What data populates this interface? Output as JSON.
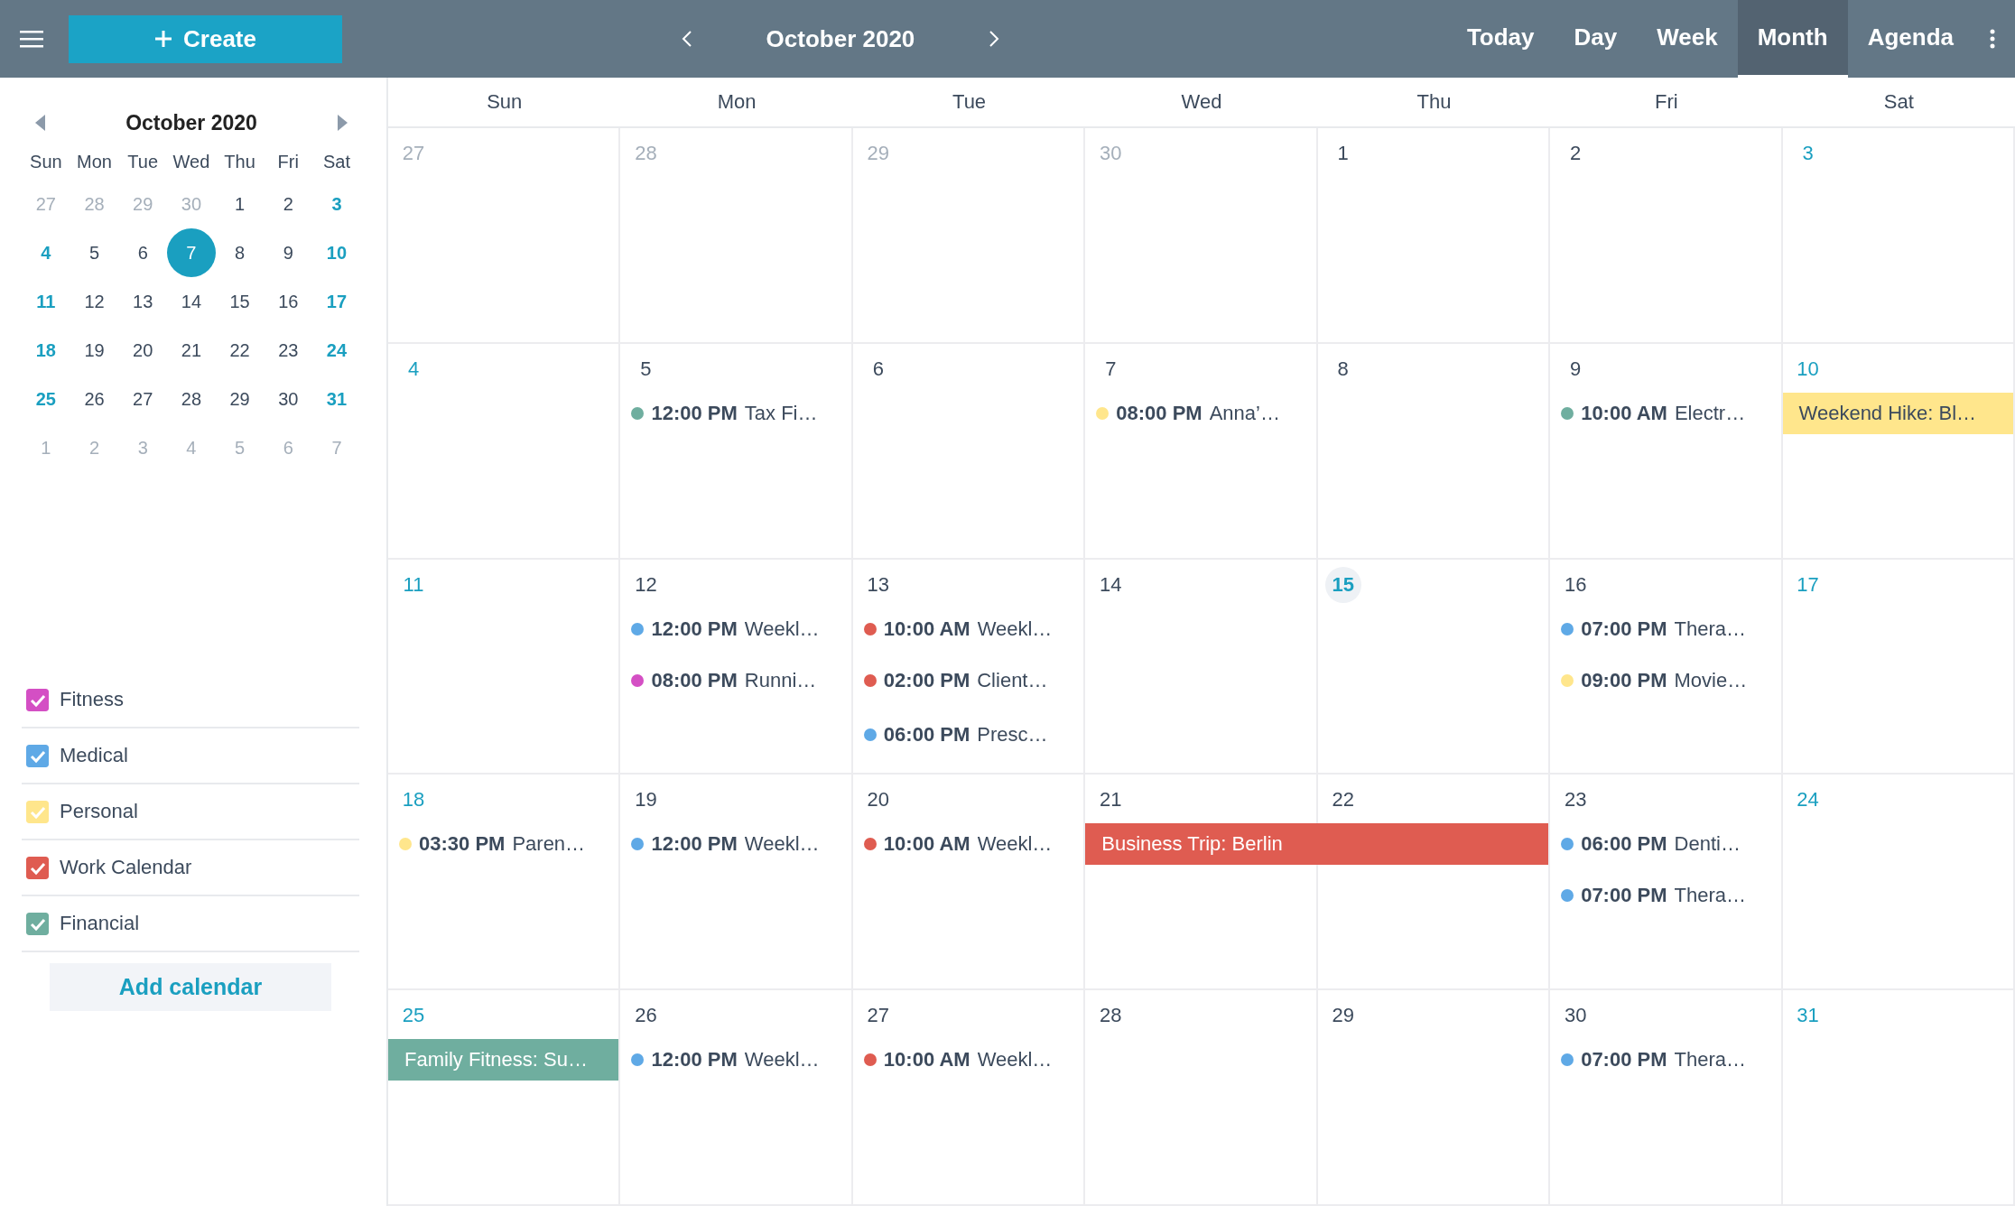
{
  "topbar": {
    "create_label": "Create",
    "title": "October 2020",
    "views": [
      {
        "label": "Today",
        "selected": false
      },
      {
        "label": "Day",
        "selected": false
      },
      {
        "label": "Week",
        "selected": false
      },
      {
        "label": "Month",
        "selected": true
      },
      {
        "label": "Agenda",
        "selected": false
      }
    ]
  },
  "sidebar": {
    "mini_calendar": {
      "title": "October 2020",
      "weekdays": [
        "Sun",
        "Mon",
        "Tue",
        "Wed",
        "Thu",
        "Fri",
        "Sat"
      ],
      "weeks": [
        [
          {
            "day": "27",
            "kind": "other",
            "selected": false
          },
          {
            "day": "28",
            "kind": "other",
            "selected": false
          },
          {
            "day": "29",
            "kind": "other",
            "selected": false
          },
          {
            "day": "30",
            "kind": "other",
            "selected": false
          },
          {
            "day": "1",
            "kind": "normal",
            "selected": false
          },
          {
            "day": "2",
            "kind": "normal",
            "selected": false
          },
          {
            "day": "3",
            "kind": "weekend",
            "selected": false
          }
        ],
        [
          {
            "day": "4",
            "kind": "weekend",
            "selected": false
          },
          {
            "day": "5",
            "kind": "normal",
            "selected": false
          },
          {
            "day": "6",
            "kind": "normal",
            "selected": false
          },
          {
            "day": "7",
            "kind": "normal",
            "selected": true
          },
          {
            "day": "8",
            "kind": "normal",
            "selected": false
          },
          {
            "day": "9",
            "kind": "normal",
            "selected": false
          },
          {
            "day": "10",
            "kind": "weekend",
            "selected": false
          }
        ],
        [
          {
            "day": "11",
            "kind": "weekend",
            "selected": false
          },
          {
            "day": "12",
            "kind": "normal",
            "selected": false
          },
          {
            "day": "13",
            "kind": "normal",
            "selected": false
          },
          {
            "day": "14",
            "kind": "normal",
            "selected": false
          },
          {
            "day": "15",
            "kind": "normal",
            "selected": false
          },
          {
            "day": "16",
            "kind": "normal",
            "selected": false
          },
          {
            "day": "17",
            "kind": "weekend",
            "selected": false
          }
        ],
        [
          {
            "day": "18",
            "kind": "weekend",
            "selected": false
          },
          {
            "day": "19",
            "kind": "normal",
            "selected": false
          },
          {
            "day": "20",
            "kind": "normal",
            "selected": false
          },
          {
            "day": "21",
            "kind": "normal",
            "selected": false
          },
          {
            "day": "22",
            "kind": "normal",
            "selected": false
          },
          {
            "day": "23",
            "kind": "normal",
            "selected": false
          },
          {
            "day": "24",
            "kind": "weekend",
            "selected": false
          }
        ],
        [
          {
            "day": "25",
            "kind": "weekend",
            "selected": false
          },
          {
            "day": "26",
            "kind": "normal",
            "selected": false
          },
          {
            "day": "27",
            "kind": "normal",
            "selected": false
          },
          {
            "day": "28",
            "kind": "normal",
            "selected": false
          },
          {
            "day": "29",
            "kind": "normal",
            "selected": false
          },
          {
            "day": "30",
            "kind": "normal",
            "selected": false
          },
          {
            "day": "31",
            "kind": "weekend",
            "selected": false
          }
        ],
        [
          {
            "day": "1",
            "kind": "other",
            "selected": false
          },
          {
            "day": "2",
            "kind": "other",
            "selected": false
          },
          {
            "day": "3",
            "kind": "other",
            "selected": false
          },
          {
            "day": "4",
            "kind": "other",
            "selected": false
          },
          {
            "day": "5",
            "kind": "other",
            "selected": false
          },
          {
            "day": "6",
            "kind": "other",
            "selected": false
          },
          {
            "day": "7",
            "kind": "other",
            "selected": false
          }
        ]
      ]
    },
    "calendars": [
      {
        "name": "Fitness",
        "checked": true,
        "color": "#d44fc4"
      },
      {
        "name": "Medical",
        "checked": true,
        "color": "#5fa9e6"
      },
      {
        "name": "Personal",
        "checked": true,
        "color": "#ffe68c"
      },
      {
        "name": "Work Calendar",
        "checked": true,
        "color": "#df5c51"
      },
      {
        "name": "Financial",
        "checked": true,
        "color": "#6fae9f"
      }
    ],
    "add_calendar": "Add calendar"
  },
  "month": {
    "weekdays": [
      "Sun",
      "Mon",
      "Tue",
      "Wed",
      "Thu",
      "Fri",
      "Sat"
    ],
    "weeks": [
      [
        {
          "day": "27",
          "kind": "other",
          "today": false
        },
        {
          "day": "28",
          "kind": "other",
          "today": false
        },
        {
          "day": "29",
          "kind": "other",
          "today": false
        },
        {
          "day": "30",
          "kind": "other",
          "today": false
        },
        {
          "day": "1",
          "kind": "normal",
          "today": false
        },
        {
          "day": "2",
          "kind": "normal",
          "today": false
        },
        {
          "day": "3",
          "kind": "weekend",
          "today": false
        }
      ],
      [
        {
          "day": "4",
          "kind": "weekend",
          "today": false
        },
        {
          "day": "5",
          "kind": "normal",
          "today": false,
          "events": [
            {
              "kind": "timed",
              "time": "12:00 PM",
              "title": "Tax Fi…",
              "color": "#6fae9f"
            }
          ]
        },
        {
          "day": "6",
          "kind": "normal",
          "today": false
        },
        {
          "day": "7",
          "kind": "normal",
          "today": false,
          "events": [
            {
              "kind": "timed",
              "time": "08:00 PM",
              "title": "Anna’…",
              "color": "#ffe68c"
            }
          ]
        },
        {
          "day": "8",
          "kind": "normal",
          "today": false
        },
        {
          "day": "9",
          "kind": "normal",
          "today": false,
          "events": [
            {
              "kind": "timed",
              "time": "10:00 AM",
              "title": "Electr…",
              "color": "#6fae9f"
            }
          ]
        },
        {
          "day": "10",
          "kind": "weekend",
          "today": false,
          "events": [
            {
              "kind": "allday",
              "title": "Weekend Hike: Bl…",
              "color": "#ffe68c"
            }
          ]
        }
      ],
      [
        {
          "day": "11",
          "kind": "weekend",
          "today": false
        },
        {
          "day": "12",
          "kind": "normal",
          "today": false,
          "events": [
            {
              "kind": "timed",
              "time": "12:00 PM",
              "title": "Weekl…",
              "color": "#5fa9e6"
            },
            {
              "kind": "timed",
              "time": "08:00 PM",
              "title": "Runni…",
              "color": "#d44fc4"
            }
          ]
        },
        {
          "day": "13",
          "kind": "normal",
          "today": false,
          "events": [
            {
              "kind": "timed",
              "time": "10:00 AM",
              "title": "Weekl…",
              "color": "#df5c51"
            },
            {
              "kind": "timed",
              "time": "02:00 PM",
              "title": "Client…",
              "color": "#df5c51"
            },
            {
              "kind": "timed",
              "time": "06:00 PM",
              "title": "Presc…",
              "color": "#5fa9e6"
            }
          ]
        },
        {
          "day": "14",
          "kind": "normal",
          "today": false
        },
        {
          "day": "15",
          "kind": "normal",
          "today": true
        },
        {
          "day": "16",
          "kind": "normal",
          "today": false,
          "events": [
            {
              "kind": "timed",
              "time": "07:00 PM",
              "title": "Thera…",
              "color": "#5fa9e6"
            },
            {
              "kind": "timed",
              "time": "09:00 PM",
              "title": "Movie…",
              "color": "#ffe68c"
            }
          ]
        },
        {
          "day": "17",
          "kind": "weekend",
          "today": false
        }
      ],
      [
        {
          "day": "18",
          "kind": "weekend",
          "today": false,
          "events": [
            {
              "kind": "timed",
              "time": "03:30 PM",
              "title": "Paren…",
              "color": "#ffe68c"
            }
          ]
        },
        {
          "day": "19",
          "kind": "normal",
          "today": false,
          "events": [
            {
              "kind": "timed",
              "time": "12:00 PM",
              "title": "Weekl…",
              "color": "#5fa9e6"
            }
          ]
        },
        {
          "day": "20",
          "kind": "normal",
          "today": false,
          "events": [
            {
              "kind": "timed",
              "time": "10:00 AM",
              "title": "Weekl…",
              "color": "#df5c51"
            }
          ]
        },
        {
          "day": "21",
          "kind": "normal",
          "today": false,
          "events": [
            {
              "kind": "allday",
              "title": "Business Trip: Berlin",
              "color": "#df5c51"
            }
          ]
        },
        {
          "day": "22",
          "kind": "normal",
          "today": false,
          "continued": true
        },
        {
          "day": "23",
          "kind": "normal",
          "today": false,
          "events": [
            {
              "kind": "timed",
              "time": "06:00 PM",
              "title": "Denti…",
              "color": "#5fa9e6"
            },
            {
              "kind": "timed",
              "time": "07:00 PM",
              "title": "Thera…",
              "color": "#5fa9e6"
            }
          ]
        },
        {
          "day": "24",
          "kind": "weekend",
          "today": false
        }
      ],
      [
        {
          "day": "25",
          "kind": "weekend",
          "today": false,
          "events": [
            {
              "kind": "allday",
              "title": "Family Fitness: Su…",
              "color": "#6fae9f"
            }
          ]
        },
        {
          "day": "26",
          "kind": "normal",
          "today": false,
          "events": [
            {
              "kind": "timed",
              "time": "12:00 PM",
              "title": "Weekl…",
              "color": "#5fa9e6"
            }
          ]
        },
        {
          "day": "27",
          "kind": "normal",
          "today": false,
          "events": [
            {
              "kind": "timed",
              "time": "10:00 AM",
              "title": "Weekl…",
              "color": "#df5c51"
            }
          ]
        },
        {
          "day": "28",
          "kind": "normal",
          "today": false
        },
        {
          "day": "29",
          "kind": "normal",
          "today": false
        },
        {
          "day": "30",
          "kind": "normal",
          "today": false,
          "events": [
            {
              "kind": "timed",
              "time": "07:00 PM",
              "title": "Thera…",
              "color": "#5fa9e6"
            }
          ]
        },
        {
          "day": "31",
          "kind": "weekend",
          "today": false
        }
      ]
    ]
  }
}
